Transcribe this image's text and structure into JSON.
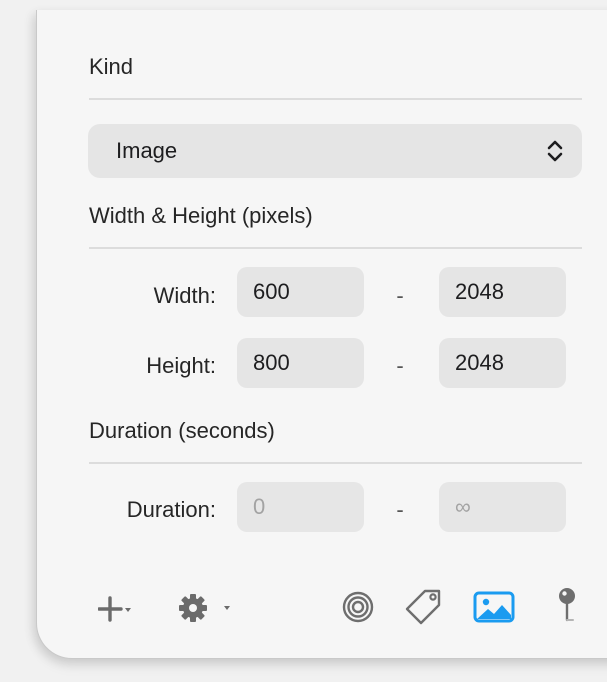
{
  "sections": {
    "kind": "Kind",
    "size": "Width & Height (pixels)",
    "duration": "Duration (seconds)"
  },
  "kind_popup": {
    "selected": "Image"
  },
  "width_row": {
    "label": "Width:",
    "min": "600",
    "separator": "-",
    "max": "2048"
  },
  "height_row": {
    "label": "Height:",
    "min": "800",
    "separator": "-",
    "max": "2048"
  },
  "duration_row": {
    "label": "Duration:",
    "min": "0",
    "separator": "-",
    "max": "∞"
  },
  "toolbar": {
    "icons": [
      "plus-icon",
      "gear-icon",
      "target-icon",
      "tag-icon",
      "image-icon",
      "location-pin-icon"
    ],
    "selected": "image-icon",
    "accent": "#1a9bf0"
  }
}
